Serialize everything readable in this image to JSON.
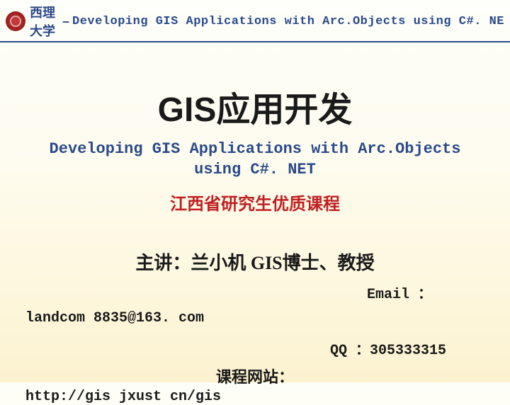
{
  "header": {
    "university": "西理 大学",
    "separator": "–",
    "subtitle": "Developing GIS Applications with Arc.Objects using C#. NE"
  },
  "title": "GIS应用开发",
  "subtitle": "Developing GIS Applications with Arc.Objects using C#. NET",
  "course_tag": "江西省研究生优质课程",
  "lecturer": "主讲：兰小机   GIS博士、教授",
  "email_label": "Email ：",
  "email_value": "landcom 8835@163. com",
  "qq": "QQ ：305333315",
  "website_label": "课程网站：",
  "website_url": "http://gis jxust cn/gis"
}
